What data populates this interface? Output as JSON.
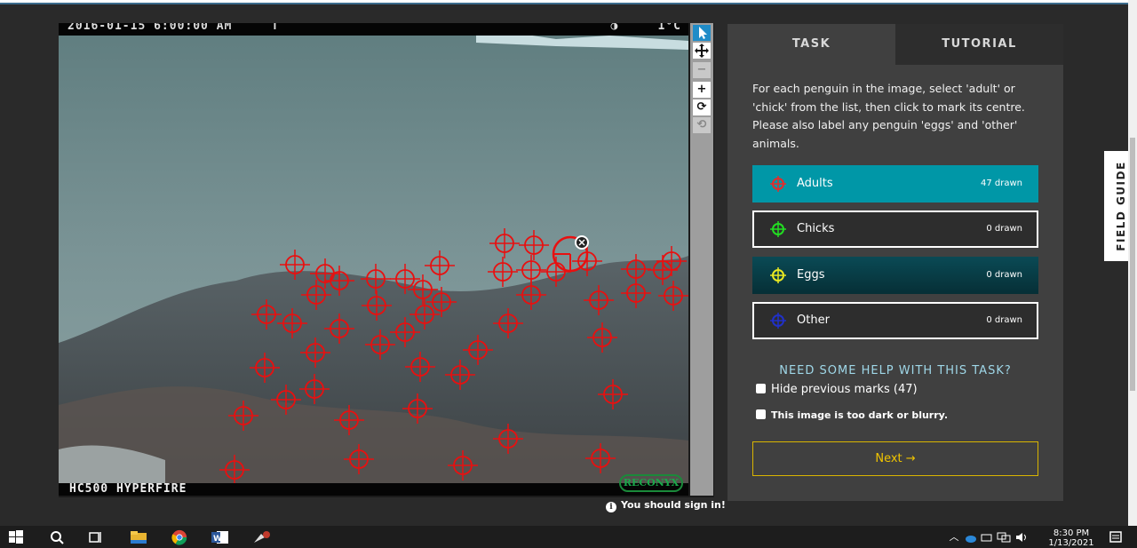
{
  "viewer": {
    "timestamp": "2016-01-15 6:00:00 AM",
    "timestamp_extra": "T",
    "temperature": "1°C",
    "camera_model": "HC500 HYPERFIRE",
    "camera_brand": "RECONYX",
    "toolbar": {
      "pointer_icon": "cursor-arrow-icon",
      "move_icon": "move-arrows-icon",
      "zoom_out_label": "−",
      "zoom_in_label": "+",
      "rotate_label": "⟳",
      "reset_label": "⟲"
    },
    "sign_in_text": "You should sign in!",
    "mark_color": "#e81010",
    "mark_count": 47
  },
  "panel": {
    "tabs": {
      "task": "TASK",
      "tutorial": "TUTORIAL"
    },
    "instructions": "For each penguin in the image, select 'adult' or 'chick' from the list, then click to mark its centre. Please also label any penguin 'eggs' and 'other' animals.",
    "tools": [
      {
        "label": "Adults",
        "count": "47 drawn",
        "color": "#e52b2b"
      },
      {
        "label": "Chicks",
        "count": "0 drawn",
        "color": "#22dd22"
      },
      {
        "label": "Eggs",
        "count": "0 drawn",
        "color": "#e8e822"
      },
      {
        "label": "Other",
        "count": "0 drawn",
        "color": "#2030c8"
      }
    ],
    "help_link": "NEED SOME HELP WITH THIS TASK?",
    "hide_marks_label": "Hide previous marks (47)",
    "too_dark_label": "This image is too dark or blurry.",
    "next_label": "Next →",
    "active_color": "#0097a7",
    "next_color": "#f0c400"
  },
  "field_guide_label": "FIELD GUIDE",
  "taskbar": {
    "time": "8:30 PM",
    "date": "1/13/2021"
  }
}
